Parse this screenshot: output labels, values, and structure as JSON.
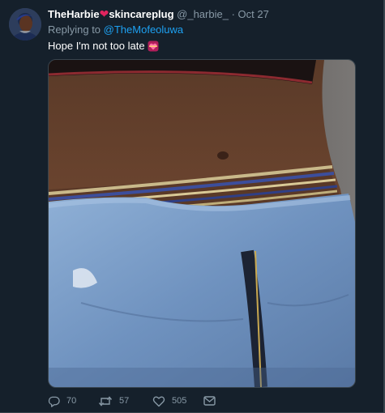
{
  "tweet": {
    "display_name_part1": "TheHarbie",
    "heart_glyph": "❤",
    "display_name_part2": "skincareplug",
    "handle": "@_harbie_",
    "separator": "·",
    "date": "Oct 27",
    "replying_prefix": "Replying to",
    "replying_to": "@TheMofeoluwa",
    "text": "Hope I'm not too late",
    "emoji_icon": "heart-ribbon-emoji",
    "media_icon": "photo"
  },
  "actions": {
    "reply_icon": "reply-bubble-icon",
    "reply_count": "70",
    "retweet_icon": "retweet-icon",
    "retweet_count": "57",
    "like_icon": "heart-outline-icon",
    "like_count": "505",
    "share_icon": "envelope-icon"
  },
  "colors": {
    "background": "#15202b",
    "text": "#ffffff",
    "muted": "#8899a6",
    "link": "#1da1f2",
    "heart": "#e0245e",
    "border": "#38444d"
  }
}
